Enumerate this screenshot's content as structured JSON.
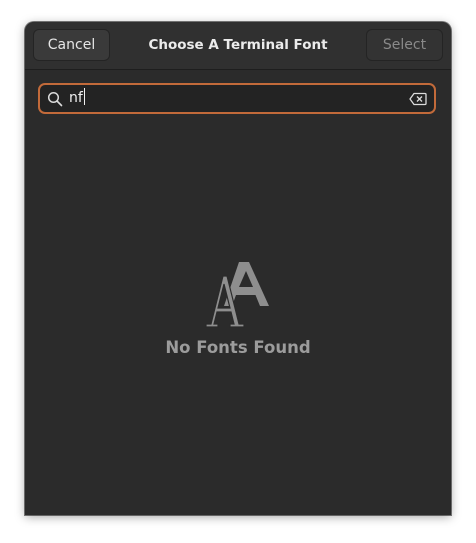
{
  "dialog": {
    "title": "Choose A Terminal Font",
    "cancel_label": "Cancel",
    "select_label": "Select",
    "select_enabled": false
  },
  "search": {
    "value": "nf",
    "focused": true,
    "accent_color": "#c26a3a"
  },
  "empty_state": {
    "icon": "font-icon",
    "label": "No Fonts Found"
  },
  "colors": {
    "background": "#2b2b2b",
    "headerbar": "#303030",
    "muted_text": "#9c9c9c"
  }
}
